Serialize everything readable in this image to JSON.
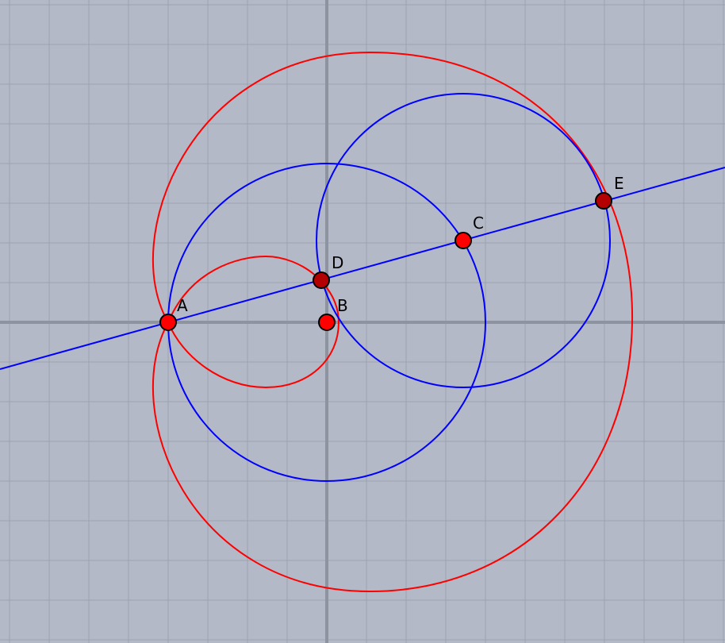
{
  "diagram": {
    "points": [
      {
        "label": "A",
        "fill": "#ff0000",
        "stroke": "#000000"
      },
      {
        "label": "B",
        "fill": "#ff0000",
        "stroke": "#000000"
      },
      {
        "label": "C",
        "fill": "#ff0000",
        "stroke": "#000000"
      },
      {
        "label": "D",
        "fill": "#b30000",
        "stroke": "#000000"
      },
      {
        "label": "E",
        "fill": "#b30000",
        "stroke": "#000000"
      }
    ],
    "colors": {
      "background": "#b3b9c6",
      "grid": "#9da4b1",
      "axis": "#8e949f",
      "blue_curves": "#0000ff",
      "red_curves": "#ff0000"
    }
  }
}
